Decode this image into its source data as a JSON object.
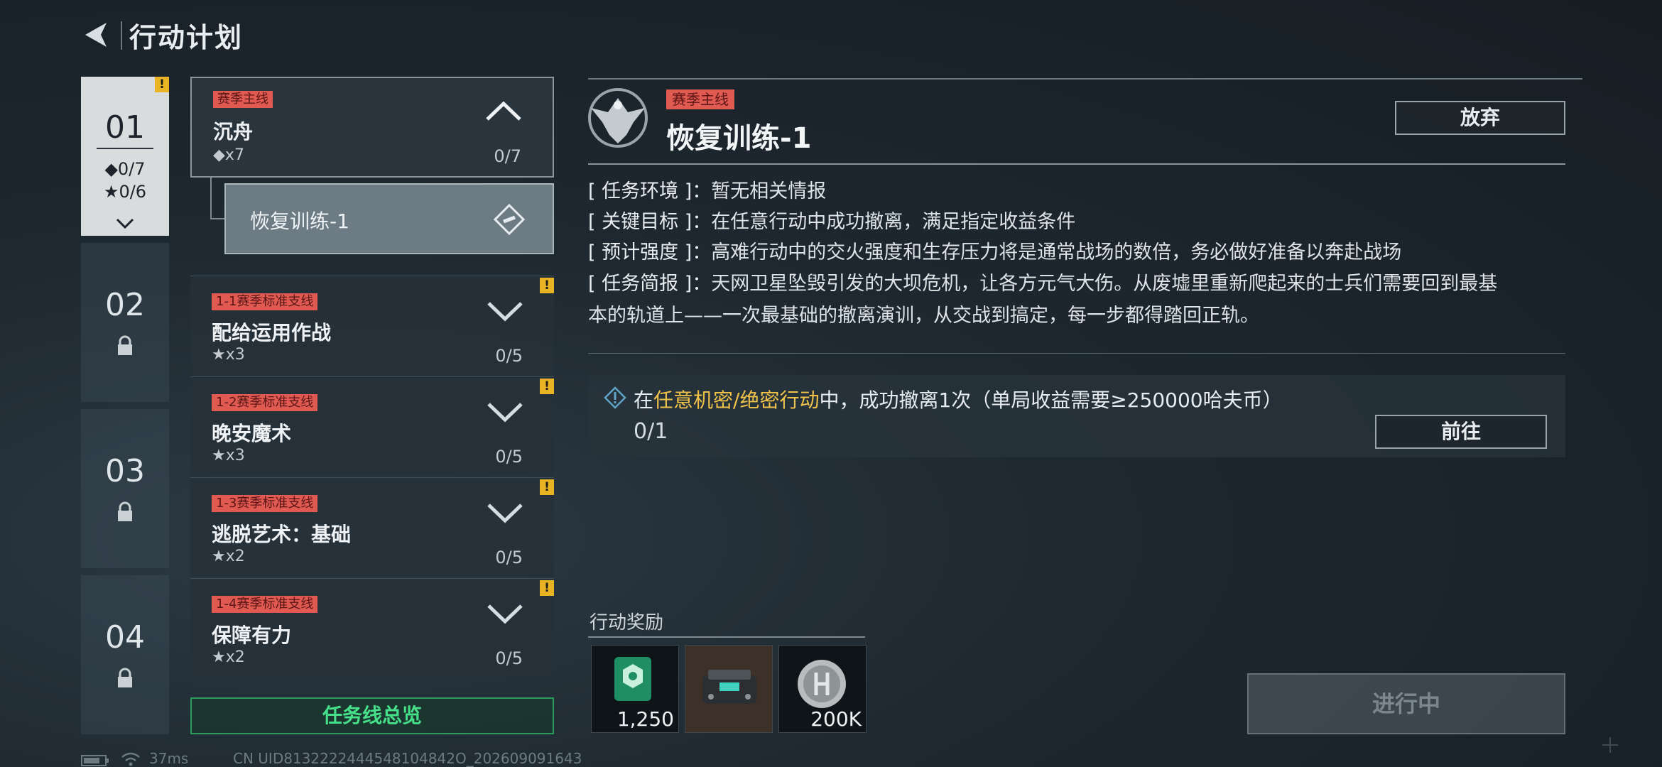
{
  "header": {
    "title": "行动计划"
  },
  "chapters": [
    {
      "num": "01",
      "diamond": "◆0/7",
      "star": "★0/6",
      "alert": "!"
    },
    {
      "num": "02"
    },
    {
      "num": "03"
    },
    {
      "num": "04"
    }
  ],
  "missions": {
    "main": {
      "tag": "赛季主线",
      "name": "沉舟",
      "req": "◆x7",
      "progress": "0/7"
    },
    "sub": {
      "label": "恢复训练-1"
    },
    "list": [
      {
        "tag": "1-1赛季标准支线",
        "name": "配给运用作战",
        "req": "★x3",
        "progress": "0/5",
        "alert": "!"
      },
      {
        "tag": "1-2赛季标准支线",
        "name": "晚安魔术",
        "req": "★x3",
        "progress": "0/5",
        "alert": "!"
      },
      {
        "tag": "1-3赛季标准支线",
        "name": "逃脱艺术：基础",
        "req": "★x2",
        "progress": "0/5",
        "alert": "!"
      },
      {
        "tag": "1-4赛季标准支线",
        "name": "保障有力",
        "req": "★x2",
        "progress": "0/5",
        "alert": "!"
      }
    ],
    "overview_label": "任务线总览"
  },
  "detail": {
    "tag": "赛季主线",
    "title": "恢复训练-1",
    "abandon_label": "放弃",
    "info": [
      {
        "label": "[ 任务环境 ]：",
        "value": "暂无相关情报"
      },
      {
        "label": "[ 关键目标 ]：",
        "value": "在任意行动中成功撤离，满足指定收益条件"
      },
      {
        "label": "[ 预计强度 ]：",
        "value": "高难行动中的交火强度和生存压力将是通常战场的数倍，务必做好准备以奔赴战场"
      },
      {
        "label": "[ 任务简报 ]：",
        "value": "天网卫星坠毁引发的大坝危机，让各方元气大伤。从废墟里重新爬起来的士兵们需要回到最基"
      }
    ],
    "brief_cont": "本的轨道上——一次最基础的撤离演训，从交战到搞定，每一步都得踏回正轨。",
    "task": {
      "prefix": "在",
      "highlight": "任意机密/绝密行动",
      "suffix": "中，成功撤离1次（单局收益需要≥250000哈夫币）",
      "progress": "0/1",
      "go_label": "前往"
    },
    "reward_title": "行动奖励",
    "rewards": [
      {
        "icon": "badge-icon",
        "qty": "1,250"
      },
      {
        "icon": "device-icon",
        "qty": ""
      },
      {
        "icon": "coin-icon",
        "qty": "200K"
      }
    ],
    "status_button": "进行中"
  },
  "status": {
    "ping": "37ms",
    "uid": "CN UID8132222444548104842O_202609091643"
  },
  "colors": {
    "accent_red": "#e05a52",
    "accent_green": "#46e08a",
    "highlight": "#f0c24a",
    "alert": "#e8b423"
  }
}
